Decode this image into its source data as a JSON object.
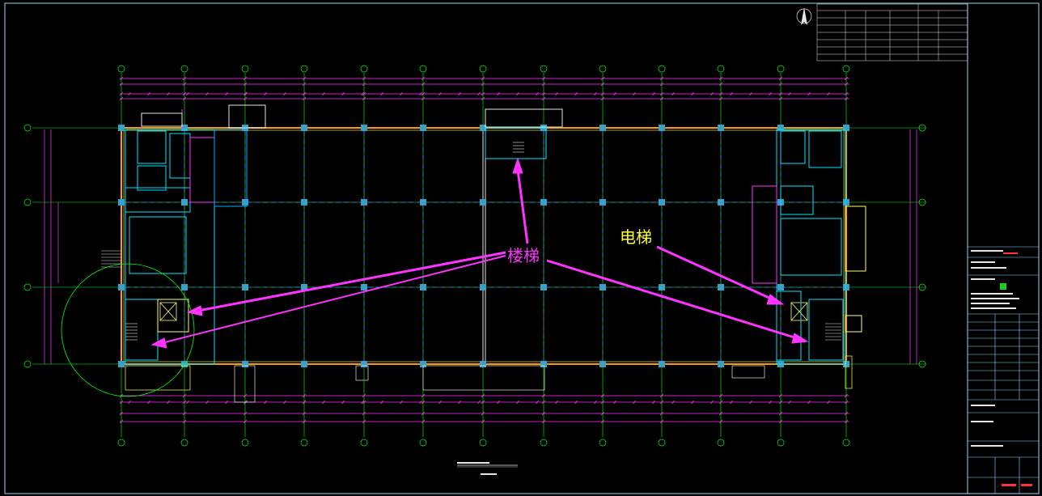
{
  "drawing": {
    "annotations": {
      "stair_label": "楼梯",
      "elevator_label": "电梯"
    },
    "colors": {
      "background": "#000000",
      "axis_lines": "#00ff00",
      "dimensions": "#ff33ff",
      "walls": "#00e5ff",
      "outer_wall": "#ff9900",
      "grid_dashes": "#4a7cff",
      "columns": "#39a0c8",
      "arrows": "#ff33ff",
      "elevator_text": "#ffff33",
      "title_block_frame": "#8fd7ff"
    },
    "icons": [
      "north-arrow-icon",
      "axis-bubble-icon",
      "column-icon",
      "elevator-shaft-icon",
      "stair-icon"
    ]
  }
}
